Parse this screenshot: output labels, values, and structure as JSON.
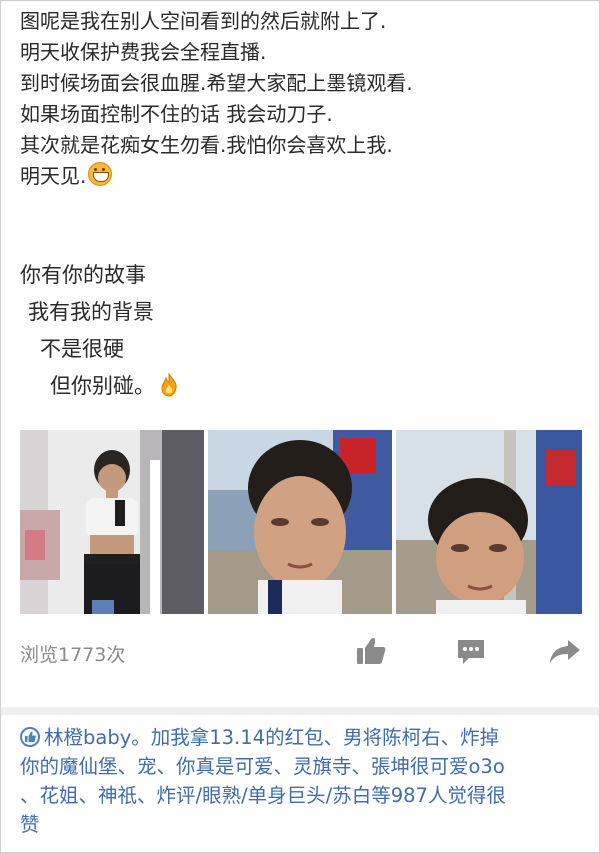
{
  "post": {
    "lines": [
      "图呢是我在别人空间看到的然后就附上了.",
      "明天收保护费我会全程直播.",
      "到时候场面会很血腥.希望大家配上墨镜观看.",
      "如果场面控制不住的话 我会动刀子.",
      "其次就是花痴女生勿看.我怕你会喜欢上我.",
      "明天见."
    ],
    "poem": [
      "你有你的故事",
      "我有我的背景",
      "不是很硬",
      "但你别碰。"
    ]
  },
  "photos": {
    "icons": [
      "grin-emoji-icon",
      "fire-icon"
    ]
  },
  "stats": {
    "views": "浏览1773次"
  },
  "actions": {
    "icons": [
      "thumbs-up-icon",
      "comment-icon",
      "share-icon"
    ]
  },
  "likes": {
    "line1": "林橙baby。加我拿13.14的红包、男将陈柯右、炸掉",
    "line2": "你的魔仙堡、宠、你真是可爱、灵旗寺、張坤很可爱o3o",
    "line3": "、花姐、神祇、炸评/眼熟/单身巨头/苏白等987人觉得很",
    "line4": "赞"
  },
  "colors": {
    "link": "#3f6ea8",
    "meta": "#8a8a8a",
    "divider": "#efefef"
  }
}
